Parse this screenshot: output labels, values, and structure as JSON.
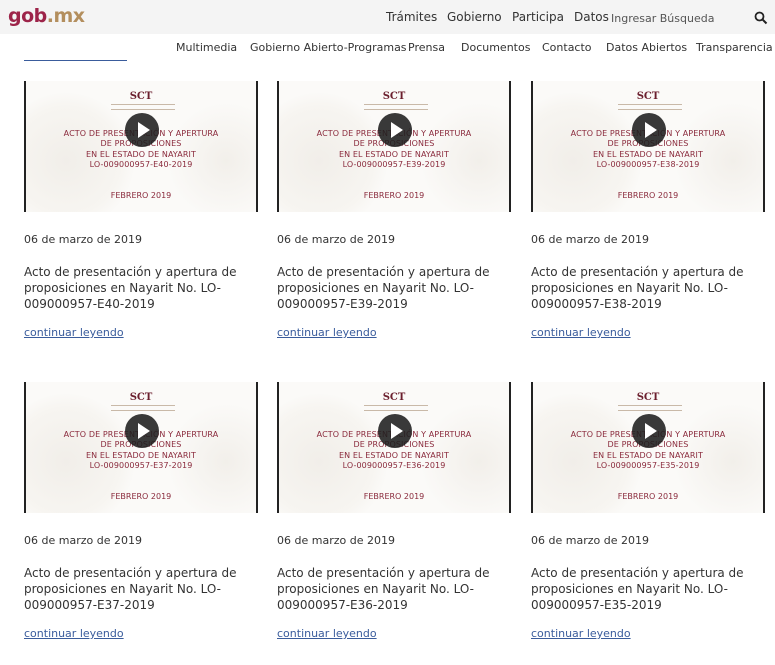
{
  "header": {
    "logo_gob": "gob",
    "logo_mx": ".mx",
    "nav": [
      "Trámites",
      "Gobierno",
      "Participa",
      "Datos"
    ],
    "search_placeholder": "Ingresar Búsqueda",
    "search_icon": "search-icon"
  },
  "subnav": [
    "Multimedia",
    "Gobierno Abierto-Programas",
    "Prensa",
    "Documentos",
    "Contacto",
    "Datos Abiertos",
    "Transparencia"
  ],
  "colors": {
    "brand": "#9d2449",
    "gold": "#b38e5d",
    "link": "#3a5c9c"
  },
  "cards": [
    {
      "thumb": {
        "org": "SCT",
        "line1": "ACTO DE PRESENTACIÓN Y APERTURA",
        "line2": "DE PROPOSICIONES",
        "line3": "EN EL ESTADO DE NAYARIT",
        "code": "LO-009000957-E40-2019",
        "month": "FEBRERO 2019"
      },
      "date": "06 de marzo de 2019",
      "title": "Acto de presentación y apertura de proposiciones en Nayarit No. LO-009000957-E40-2019",
      "link": "continuar leyendo"
    },
    {
      "thumb": {
        "org": "SCT",
        "line1": "ACTO DE PRESENTACIÓN Y APERTURA",
        "line2": "DE PROPOSICIONES",
        "line3": "EN EL ESTADO DE NAYARIT",
        "code": "LO-009000957-E39-2019",
        "month": "FEBRERO 2019"
      },
      "date": "06 de marzo de 2019",
      "title": "Acto de presentación y apertura de proposiciones en Nayarit No. LO-009000957-E39-2019",
      "link": "continuar leyendo"
    },
    {
      "thumb": {
        "org": "SCT",
        "line1": "ACTO DE PRESENTACIÓN Y APERTURA",
        "line2": "DE PROPOSICIONES",
        "line3": "EN EL ESTADO DE NAYARIT",
        "code": "LO-009000957-E38-2019",
        "month": "FEBRERO 2019"
      },
      "date": "06 de marzo de 2019",
      "title": "Acto de presentación y apertura de proposiciones en Nayarit No. LO-009000957-E38-2019",
      "link": "continuar leyendo"
    },
    {
      "thumb": {
        "org": "SCT",
        "line1": "ACTO DE PRESENTACIÓN Y APERTURA",
        "line2": "DE PROPOSICIONES",
        "line3": "EN EL ESTADO DE NAYARIT",
        "code": "LO-009000957-E37-2019",
        "month": "FEBRERO 2019"
      },
      "date": "06 de marzo de 2019",
      "title": "Acto de presentación y apertura de proposiciones en Nayarit No. LO-009000957-E37-2019",
      "link": "continuar leyendo"
    },
    {
      "thumb": {
        "org": "SCT",
        "line1": "ACTO DE PRESENTACIÓN Y APERTURA",
        "line2": "DE PROPOSICIONES",
        "line3": "EN EL ESTADO DE NAYARIT",
        "code": "LO-009000957-E36-2019",
        "month": "FEBRERO 2019"
      },
      "date": "06 de marzo de 2019",
      "title": "Acto de presentación y apertura de proposiciones en Nayarit No. LO-009000957-E36-2019",
      "link": "continuar leyendo"
    },
    {
      "thumb": {
        "org": "SCT",
        "line1": "ACTO DE PRESENTACIÓN Y APERTURA",
        "line2": "DE PROPOSICIONES",
        "line3": "EN EL ESTADO DE NAYARIT",
        "code": "LO-009000957-E35-2019",
        "month": "FEBRERO 2019"
      },
      "date": "06 de marzo de 2019",
      "title": "Acto de presentación y apertura de proposiciones en Nayarit No. LO-009000957-E35-2019",
      "link": "continuar leyendo"
    }
  ]
}
